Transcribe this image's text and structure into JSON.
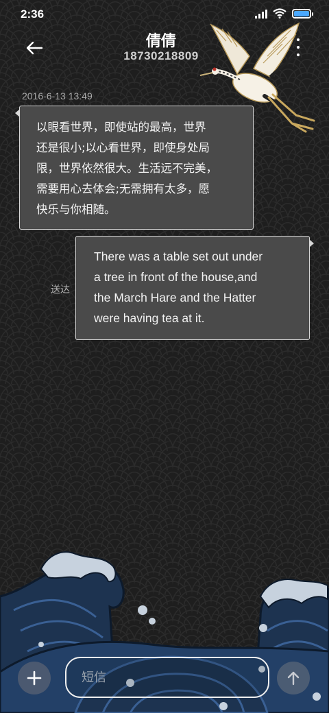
{
  "status_bar": {
    "time": "2:36",
    "battery_color": "#4aa8ff"
  },
  "header": {
    "contact_name": "倩倩",
    "phone_number": "18730218809",
    "back_icon": "arrow-left-icon",
    "menu_icon": "more-vertical-icon"
  },
  "conversation": {
    "timestamp": "2016-6-13 13:49",
    "messages": [
      {
        "direction": "incoming",
        "lines": [
          "以眼看世界，即使站的最高，世界",
          "还是很小;以心看世界，即使身处局",
          "限，世界依然很大。生活远不完美，",
          "需要用心去体会;无需拥有太多，愿",
          "快乐与你相随。"
        ]
      },
      {
        "direction": "outgoing",
        "status": "送达",
        "lines": [
          "There was a table set out under",
          "a tree in front of the house,and",
          "the March Hare and the Hatter",
          "were having tea at it."
        ]
      }
    ]
  },
  "composer": {
    "placeholder": "短信",
    "add_icon": "plus-icon",
    "send_icon": "arrow-up-icon"
  },
  "theme": {
    "wave_dark": "#1d3350",
    "wave_mid": "#2e5280",
    "foam": "#c7d2de"
  }
}
